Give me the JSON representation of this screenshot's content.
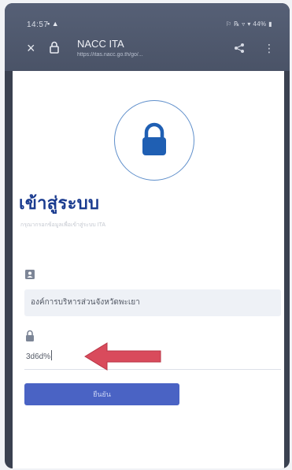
{
  "status_bar": {
    "time": "14:57",
    "right_text": "⚐ ℞ ▿ ▾ 44% ▮"
  },
  "browser": {
    "site_title": "NACC ITA",
    "url": "https://itas.nacc.go.th/go/..."
  },
  "login": {
    "title": "เข้าสู่ระบบ",
    "subtitle": "กรุณากรอกข้อมูลเพื่อเข้าสู่ระบบ ITA",
    "user_value": "องค์การบริหารส่วนจังหวัดพะเยา",
    "password_value": "3d6d%",
    "button_label": "ยืนยัน"
  },
  "colors": {
    "accent": "#4a63c4",
    "title": "#1a3b8f",
    "annotation_arrow": "#d94b5c"
  }
}
